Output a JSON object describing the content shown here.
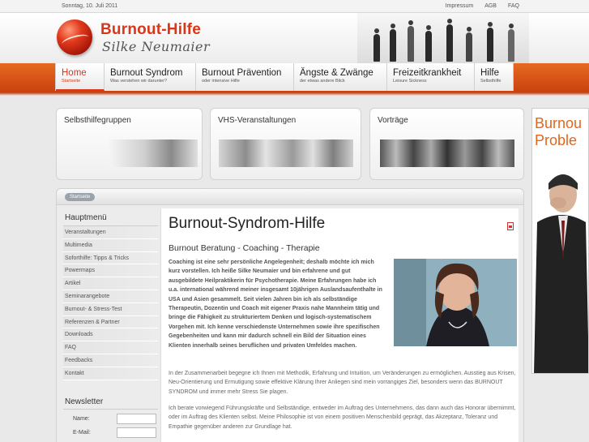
{
  "topbar": {
    "date": "Sonntag, 10. Juli 2011",
    "links": [
      "Impressum",
      "AGB",
      "FAQ"
    ]
  },
  "logo": {
    "title": "Burnout-Hilfe",
    "subtitle": "Silke Neumaier"
  },
  "nav": [
    {
      "title": "Home",
      "sub": "Startseite",
      "active": true
    },
    {
      "title": "Burnout Syndrom",
      "sub": "Was verstehen wir darunter?"
    },
    {
      "title": "Burnout Prävention",
      "sub": "oder intensive Hilfe"
    },
    {
      "title": "Ängste & Zwänge",
      "sub": "der etwas andere Blick"
    },
    {
      "title": "Freizeitkrankheit",
      "sub": "Leisure Sickness"
    },
    {
      "title": "Hilfe",
      "sub": "Selbsthilfe"
    }
  ],
  "features": [
    {
      "title": "Selbsthilfegruppen"
    },
    {
      "title": "VHS-Veranstaltungen"
    },
    {
      "title": "Vorträge"
    }
  ],
  "ad": {
    "line1": "Burnou",
    "line2": "Proble"
  },
  "breadcrumb": "Startseite",
  "sidebar": {
    "heading": "Hauptmenü",
    "items": [
      "Veranstaltungen",
      "Multimedia",
      "Soforthilfe: Tipps & Tricks",
      "Powermaps",
      "Artikel",
      "Seminarangebote",
      "Burnout- & Stress-Test",
      "Referenzen & Partner",
      "Downloads",
      "FAQ",
      "Feedbacks",
      "Kontakt"
    ],
    "newsletter": {
      "heading": "Newsletter",
      "name_label": "Name:",
      "email_label": "E-Mail:"
    }
  },
  "content": {
    "title": "Burnout-Syndrom-Hilfe",
    "subtitle": "Burnout Beratung - Coaching - Therapie",
    "intro": "Coaching ist eine sehr persönliche Angelegenheit; deshalb möchte ich mich kurz vorstellen. Ich heiße Silke Neumaier und bin erfahrene und gut ausgebildete Heilpraktikerin für Psychotherapie. Meine Erfahrungen habe ich u.a. international während meiner insgesamt 10jährigen Auslandsaufenthalte in USA und Asien gesammelt. Seit vielen Jahren bin ich als selbständige Therapeutin, Dozentin und Coach mit eigener Praxis nahe Mannheim tätig und bringe die Fähigkeit zu strukturiertem Denken und logisch-systematischem Vorgehen mit. Ich kenne verschiedenste Unternehmen sowie ihre spezifischen Gegebenheiten und kann mir dadurch schnell ein Bild der Situation eines Klienten innerhalb seines beruflichen und privaten Umfeldes machen.",
    "para1": "In der Zusammenarbeit begegne ich Ihnen mit Methodik, Erfahrung und Intuition, um Veränderungen zu ermöglichen. Ausstieg aus Krisen, Neu-Orientierung und Ermutigung sowie effektive Klärung Ihrer Anliegen sind mein vorrangiges Ziel, besonders wenn das BURNOUT SYNDROM und immer mehr Stress Sie plagen.",
    "para2": "Ich berate vorwiegend Führungskräfte und Selbständige, entweder im Auftrag des Unternehmens, das dann auch das Honorar übernimmt, oder im Auftrag des Klienten selbst. Meine Philosophie ist von einem positiven Menschenbild geprägt, das Akzeptanz, Toleranz und Empathie gegenüber anderen zur Grundlage hat."
  },
  "colors": {
    "brand": "#d9361a",
    "nav_band": "#e66a20",
    "ad_text": "#e2661c"
  }
}
